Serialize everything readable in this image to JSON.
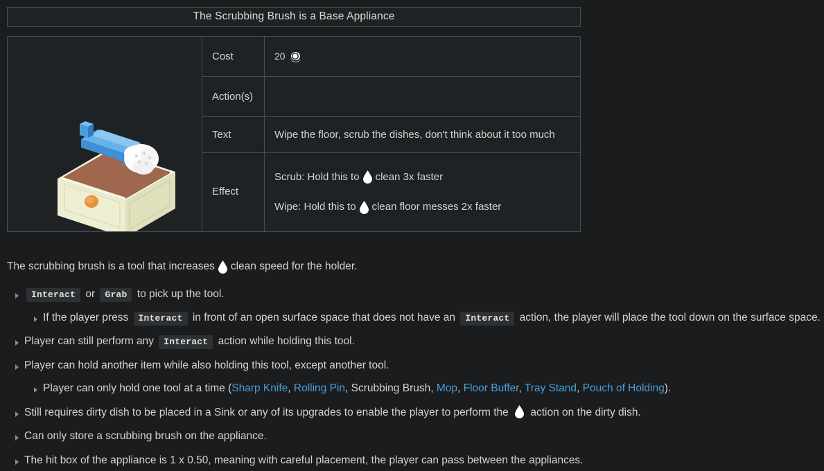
{
  "infobox": {
    "header_title": "The Scrubbing Brush is a Base Appliance",
    "image_alt": "scrubbing-brush-appliance",
    "rows": [
      {
        "label": "Cost",
        "value": "20"
      },
      {
        "label": "Action(s)",
        "value": ""
      },
      {
        "label": "Text",
        "value": "Wipe the floor, scrub the dishes, don't think about it too much"
      },
      {
        "label": "Effect",
        "value": ""
      }
    ],
    "cost_amount": "20",
    "cost_icon": "coin-icon",
    "effect": {
      "scrub_prefix": "Scrub: Hold this to",
      "scrub_icon": "water-droplet-icon",
      "scrub_suffix": "clean 3x faster",
      "wipe_prefix": "Wipe: Hold this to",
      "wipe_icon": "water-droplet-icon",
      "wipe_suffix": "clean floor messes 2x faster"
    }
  },
  "prose": {
    "lead_before": "The scrubbing brush is a tool that increases",
    "lead_icon": "water-droplet-icon",
    "lead_after": "clean speed for the holder.",
    "b1": {
      "key_interact": "Interact",
      "or": "or",
      "key_grab": "Grab",
      "tail": "to pick up the tool.",
      "sub": {
        "pre": "If the player press",
        "key1": "Interact",
        "mid": "in front of an open surface space that does not have an",
        "key2": "Interact",
        "tail": "action, the player will place the tool down on the surface space."
      }
    },
    "b2": {
      "pre": "Player can still perform any",
      "key": "Interact",
      "tail": "action while holding this tool."
    },
    "b3": {
      "text": "Player can hold another item while also holding this tool, except another tool.",
      "sub": {
        "pre": "Player can only hold one tool at a time (",
        "links": [
          {
            "label": "Sharp Knife",
            "is_link": true
          },
          {
            "label": "Rolling Pin",
            "is_link": true
          },
          {
            "label": "Scrubbing Brush",
            "is_link": false
          },
          {
            "label": "Mop",
            "is_link": true
          },
          {
            "label": "Floor Buffer",
            "is_link": true
          },
          {
            "label": "Tray Stand",
            "is_link": true
          },
          {
            "label": "Pouch of Holding",
            "is_link": true
          }
        ],
        "tail": ")."
      }
    },
    "b4": {
      "pre": "Still requires dirty dish to be placed in a Sink or any of its upgrades to enable the player to perform the",
      "icon": "water-droplet-icon",
      "tail": "action on the dirty dish."
    },
    "b5": {
      "text": "Can only store a scrubbing brush on the appliance."
    },
    "b6": {
      "text": "The hit box of the appliance is 1 x 0.50, meaning with careful placement, the player can pass between the appliances."
    }
  },
  "colors": {
    "page_bg": "#1a1c1e",
    "cell_bg": "#1f2224",
    "border": "#4a4d50",
    "text": "#d6d3ce",
    "link": "#4a9eda",
    "code_bg": "#2e3134",
    "cabinet_front": "#f2f2d8",
    "cabinet_side": "#e4e4c4",
    "counter_top": "#a0674f",
    "brush_body": "#4a9fe0",
    "brush_bristles": "#f5f5f5",
    "knob": "#e8913c"
  }
}
